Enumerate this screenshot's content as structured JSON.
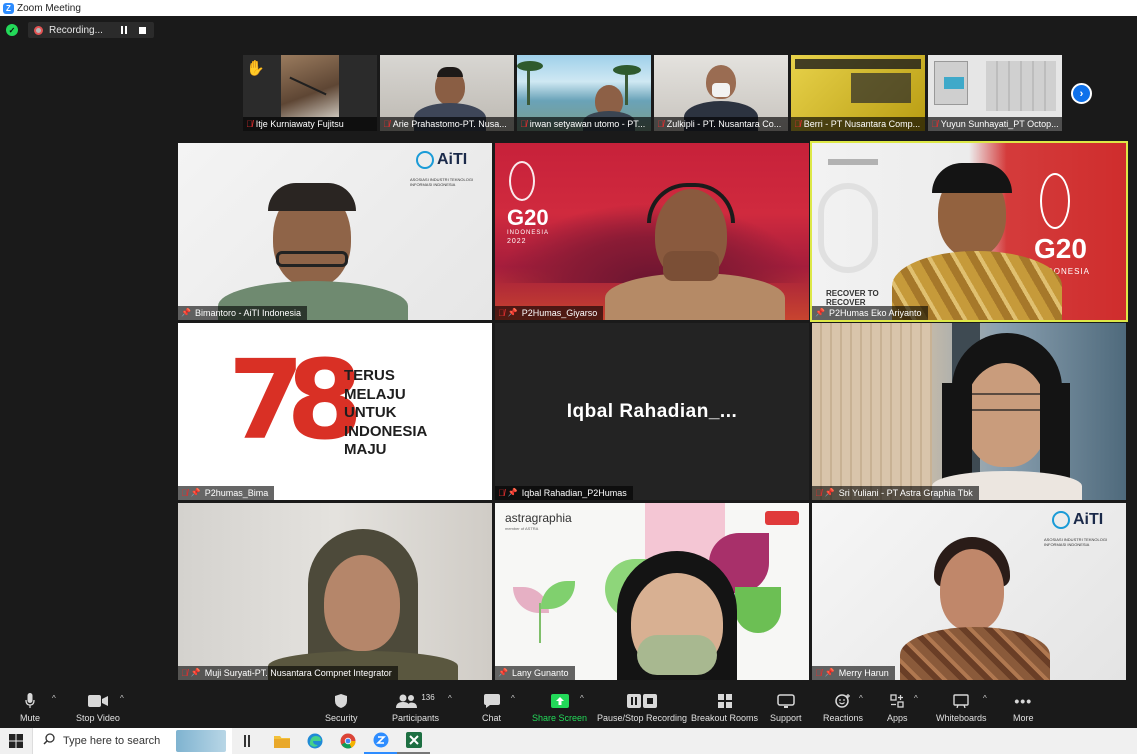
{
  "window": {
    "title": "Zoom Meeting"
  },
  "recording": {
    "label": "Recording..."
  },
  "strip": {
    "participants": [
      {
        "name": "Itje Kurniawaty Fujitsu"
      },
      {
        "name": "Arie Prahastomo-PT. Nusa..."
      },
      {
        "name": "irwan setyawan utomo - PT..."
      },
      {
        "name": "Zulkipli - PT. Nusantara Co..."
      },
      {
        "name": "Berri - PT Nusantara Comp..."
      },
      {
        "name": "Yuyun Sunhayati_PT Octop..."
      }
    ]
  },
  "gallery": {
    "tiles": [
      {
        "name": "Bimantoro - AiTI Indonesia"
      },
      {
        "name": "P2Humas_Giyarso"
      },
      {
        "name": "P2Humas Eko Ariyanto"
      },
      {
        "name": "P2humas_Bima"
      },
      {
        "name": "Iqbal Rahadian_P2Humas",
        "display_name": "Iqbal Rahadian_..."
      },
      {
        "name": "Sri Yuliani - PT Astra Graphia Tbk"
      },
      {
        "name": "Muji Suryati-PT. Nusantara Compnet Integrator"
      },
      {
        "name": "Lany Gunanto"
      },
      {
        "name": "Merry Harun"
      }
    ],
    "logos": {
      "aiti": "AiTI",
      "aiti_sub": "ASOSIASI INDUSTRI TEKNOLOGI INFORMASI INDONESIA",
      "g20": "G20",
      "g20_sub": "INDONESIA",
      "g20_year": "2022",
      "recover": "RECOVER TO",
      "recover2": "RECOVER",
      "astragraphia": "astragraphia",
      "astragraphia_sub": "member of ASTRA"
    },
    "banner_78": {
      "number": "78",
      "lines": [
        "TERUS",
        "MELAJU",
        "UNTUK",
        "INDONESIA",
        "MAJU"
      ]
    }
  },
  "toolbar": {
    "mute": "Mute",
    "stop_video": "Stop Video",
    "security": "Security",
    "participants": "Participants",
    "participants_count": "136",
    "chat": "Chat",
    "share_screen": "Share Screen",
    "pause_stop_recording": "Pause/Stop Recording",
    "breakout_rooms": "Breakout Rooms",
    "support": "Support",
    "reactions": "Reactions",
    "apps": "Apps",
    "whiteboards": "Whiteboards",
    "more": "More"
  },
  "taskbar": {
    "search_placeholder": "Type here to search"
  },
  "colors": {
    "accent": "#2d8cff",
    "share_green": "#23d959",
    "active_speaker": "#dde846",
    "muted_red": "#e02f2f"
  }
}
